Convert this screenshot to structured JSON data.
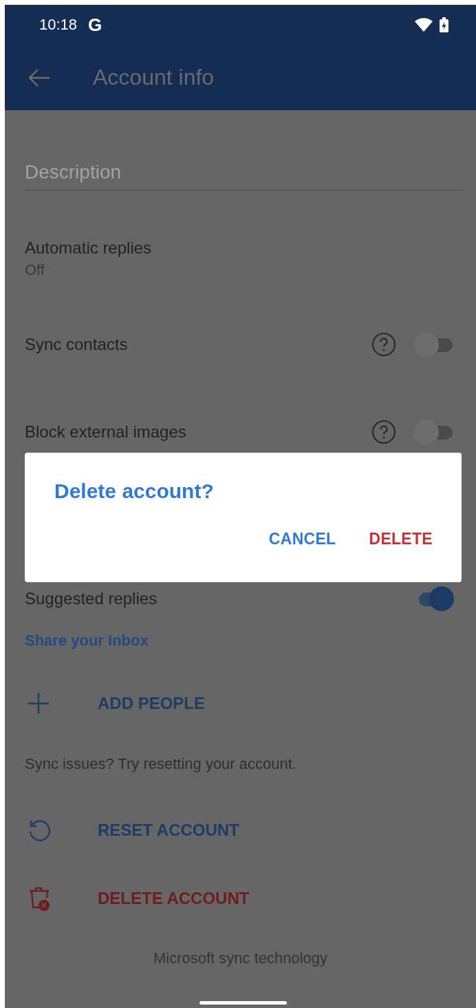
{
  "status_bar": {
    "time": "10:18",
    "logo": "G"
  },
  "app_bar": {
    "title": "Account info"
  },
  "description_field": {
    "placeholder": "Description"
  },
  "settings": [
    {
      "kind": "value",
      "label": "Automatic replies",
      "value": "Off"
    },
    {
      "kind": "toggle",
      "label": "Sync contacts",
      "help": true,
      "on": false
    },
    {
      "kind": "toggle",
      "label": "Block external images",
      "help": true,
      "on": false
    },
    {
      "kind": "toggle",
      "label": "Suggested replies",
      "help": false,
      "on": true
    }
  ],
  "share_section": {
    "heading": "Share your Inbox",
    "action": "ADD PEOPLE"
  },
  "sync_hint": "Sync issues? Try resetting your account.",
  "actions": [
    {
      "kind": "reset",
      "label": "RESET ACCOUNT"
    },
    {
      "kind": "delete",
      "label": "DELETE ACCOUNT"
    }
  ],
  "footer": "Microsoft sync technology",
  "dialog": {
    "title": "Delete account?",
    "buttons": [
      {
        "kind": "neutral",
        "label": "CANCEL"
      },
      {
        "kind": "destructive",
        "label": "DELETE"
      }
    ]
  }
}
